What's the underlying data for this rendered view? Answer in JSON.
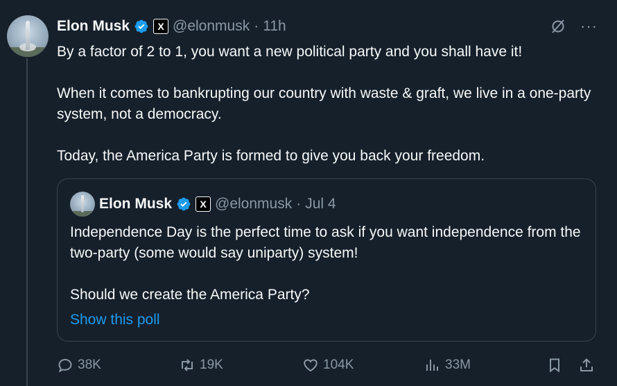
{
  "post": {
    "author_name": "Elon Musk",
    "handle": "@elonmusk",
    "separator": "·",
    "time": "11h",
    "x_badge": "X",
    "paragraphs": [
      "By a factor of 2 to 1, you want a new political party and you shall have it!",
      "When it comes to bankrupting our country with waste & graft, we live in a one-party system, not a democracy.",
      "Today, the America Party is formed to give you back your freedom."
    ],
    "more_label": "···"
  },
  "quote": {
    "author_name": "Elon Musk",
    "handle": "@elonmusk",
    "separator": "·",
    "time": "Jul 4",
    "x_badge": "X",
    "paragraphs": [
      "Independence Day is the perfect time to ask if you want independence from the two-party (some would say uniparty) system!",
      "Should we create the America Party?"
    ],
    "poll_link": "Show this poll"
  },
  "actions": {
    "replies": "38K",
    "reposts": "19K",
    "likes": "104K",
    "views": "33M"
  },
  "icons": {
    "verified": "verified-badge-icon",
    "grok": "grok-icon",
    "more": "more-icon",
    "reply": "reply-icon",
    "repost": "repost-icon",
    "like": "heart-icon",
    "views": "views-icon",
    "bookmark": "bookmark-icon",
    "share": "share-icon"
  },
  "colors": {
    "background": "#15202b",
    "text": "#f7f9f9",
    "muted": "#8b98a5",
    "accent": "#1d9bf0",
    "border": "#38444d"
  }
}
